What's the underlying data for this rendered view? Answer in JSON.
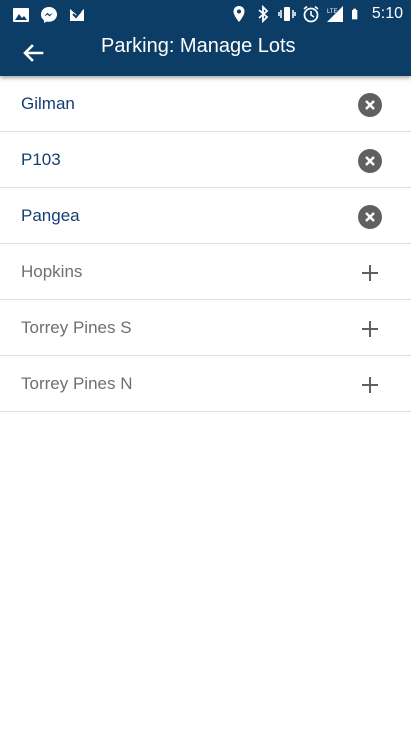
{
  "status_bar": {
    "time": "5:10",
    "left_icons": [
      "image-icon",
      "messenger-icon",
      "mail-check-icon"
    ],
    "right_icons": [
      "location-icon",
      "bluetooth-icon",
      "vibrate-icon",
      "alarm-icon",
      "lte-signal-icon",
      "battery-icon"
    ]
  },
  "header": {
    "title": "Parking: Manage Lots",
    "back_icon": "arrow-back-icon"
  },
  "colors": {
    "header_bg": "#0b3d66",
    "selected_text": "#153e73",
    "available_text": "#6f6f6f",
    "icon_gray": "#606060"
  },
  "lots": [
    {
      "label": "Gilman",
      "state": "selected",
      "action_icon": "remove-icon"
    },
    {
      "label": "P103",
      "state": "selected",
      "action_icon": "remove-icon"
    },
    {
      "label": "Pangea",
      "state": "selected",
      "action_icon": "remove-icon"
    },
    {
      "label": "Hopkins",
      "state": "available",
      "action_icon": "add-icon"
    },
    {
      "label": "Torrey Pines S",
      "state": "available",
      "action_icon": "add-icon"
    },
    {
      "label": "Torrey Pines N",
      "state": "available",
      "action_icon": "add-icon"
    }
  ]
}
